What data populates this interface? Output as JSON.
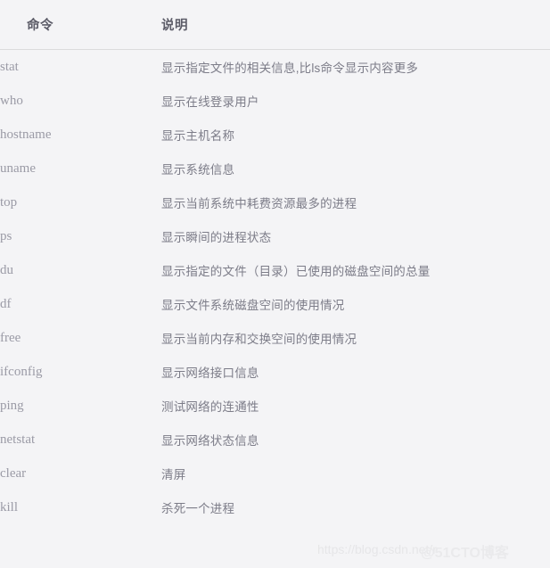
{
  "table": {
    "headers": {
      "command": "命令",
      "description": "说明"
    },
    "rows": [
      {
        "command": "stat",
        "description": "显示指定文件的相关信息,比ls命令显示内容更多"
      },
      {
        "command": "who",
        "description": "显示在线登录用户"
      },
      {
        "command": "hostname",
        "description": "显示主机名称"
      },
      {
        "command": "uname",
        "description": "显示系统信息"
      },
      {
        "command": "top",
        "description": "显示当前系统中耗费资源最多的进程"
      },
      {
        "command": "ps",
        "description": "显示瞬间的进程状态"
      },
      {
        "command": "du",
        "description": "显示指定的文件（目录）已使用的磁盘空间的总量"
      },
      {
        "command": "df",
        "description": "显示文件系统磁盘空间的使用情况"
      },
      {
        "command": "free",
        "description": "显示当前内存和交换空间的使用情况"
      },
      {
        "command": "ifconfig",
        "description": "显示网络接口信息"
      },
      {
        "command": "ping",
        "description": "测试网络的连通性"
      },
      {
        "command": "netstat",
        "description": "显示网络状态信息"
      },
      {
        "command": "clear",
        "description": "清屏"
      },
      {
        "command": "kill",
        "description": "杀死一个进程"
      }
    ]
  },
  "watermarks": {
    "url": "https://blog.csdn.net/r",
    "brand": "@51CTO博客"
  },
  "colors": {
    "background": "#f4f4f6",
    "header_text": "#5c5c68",
    "command_text": "#9b9ba6",
    "description_text": "#7c7c88",
    "divider": "#dcdcdc",
    "watermark": "#e6e6e8"
  }
}
